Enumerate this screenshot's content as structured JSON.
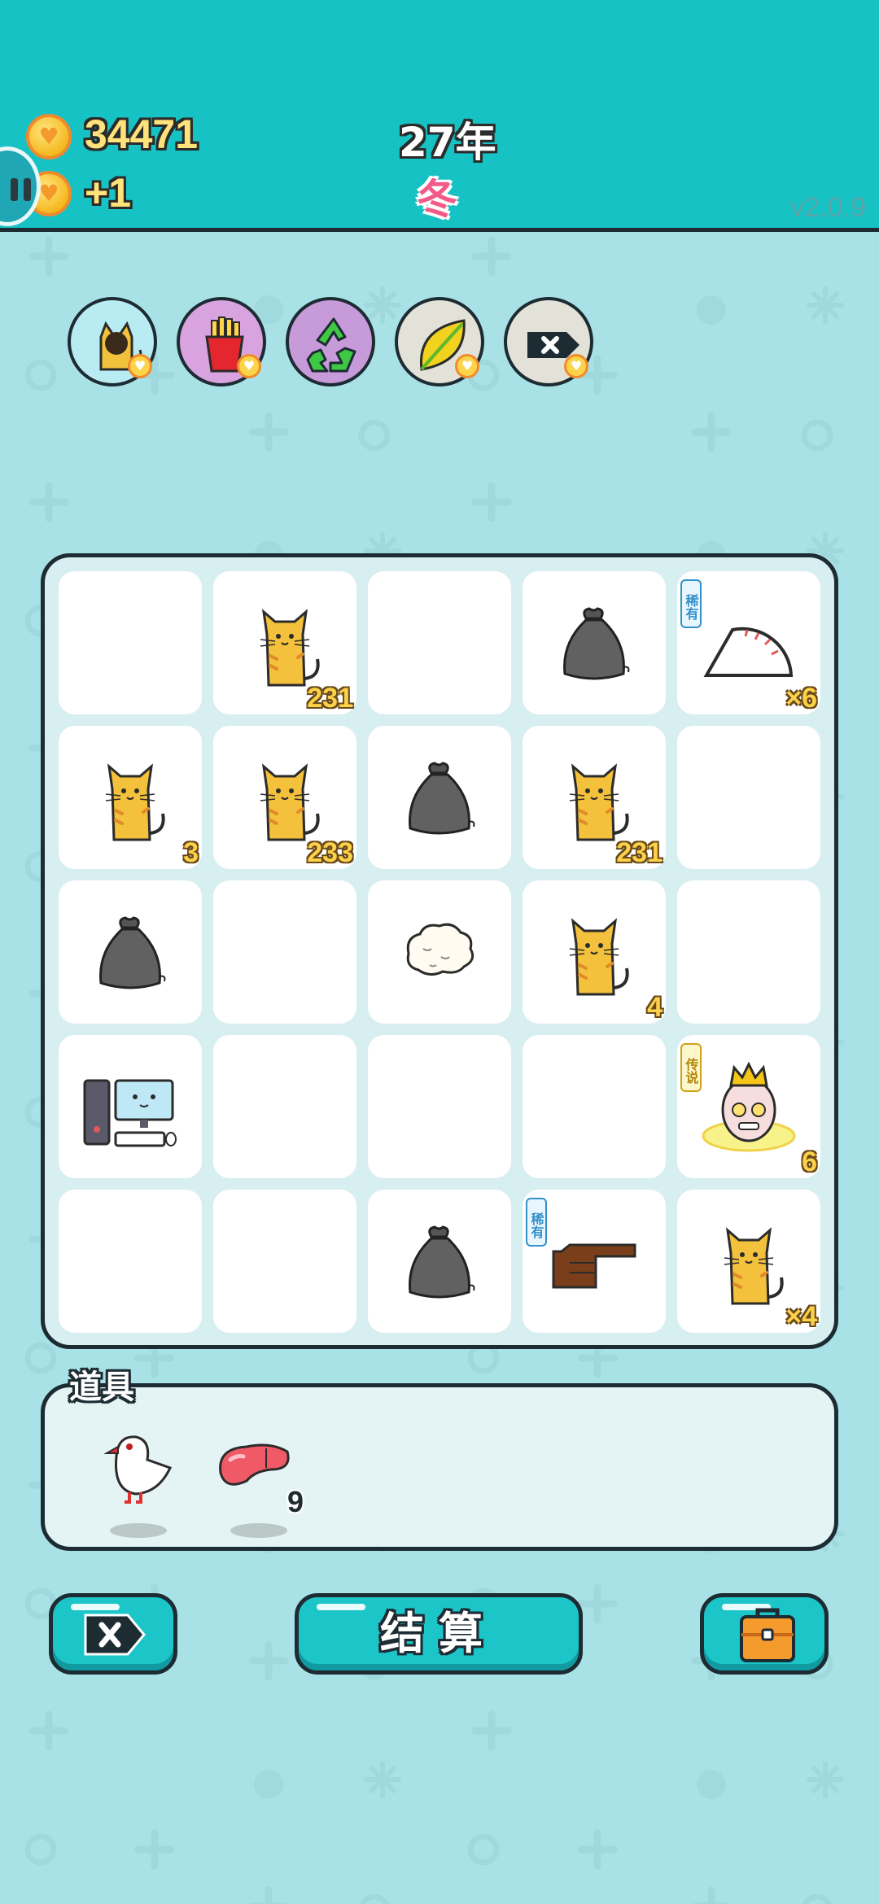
{
  "header": {
    "coins": "34471",
    "income": "+1",
    "year": "27年",
    "season": "冬",
    "version": "v2.0.9"
  },
  "skills": [
    "cat-skill-icon",
    "fries-skill-icon",
    "recycle-skill-icon",
    "leaf-skill-icon",
    "remove-skill-icon"
  ],
  "board": {
    "rows": 5,
    "cols": 5,
    "cells": [
      {
        "item": "",
        "count": ""
      },
      {
        "item": "cat",
        "count": "231"
      },
      {
        "item": "",
        "count": ""
      },
      {
        "item": "trash-bag",
        "count": ""
      },
      {
        "item": "gauge",
        "count": "×6",
        "tag": "稀有"
      },
      {
        "item": "cat",
        "count": "3"
      },
      {
        "item": "cat",
        "count": "233"
      },
      {
        "item": "trash-bag",
        "count": ""
      },
      {
        "item": "cat",
        "count": "231"
      },
      {
        "item": "",
        "count": ""
      },
      {
        "item": "trash-bag",
        "count": ""
      },
      {
        "item": "",
        "count": ""
      },
      {
        "item": "cotton",
        "count": ""
      },
      {
        "item": "cat",
        "count": "4"
      },
      {
        "item": "",
        "count": ""
      },
      {
        "item": "computer",
        "count": ""
      },
      {
        "item": "",
        "count": ""
      },
      {
        "item": "",
        "count": ""
      },
      {
        "item": "",
        "count": ""
      },
      {
        "item": "king",
        "count": "6",
        "tag": "传说"
      },
      {
        "item": "",
        "count": ""
      },
      {
        "item": "",
        "count": ""
      },
      {
        "item": "trash-bag",
        "count": ""
      },
      {
        "item": "pointing-hand",
        "count": "",
        "tag": "稀有"
      },
      {
        "item": "cat",
        "count": "×4"
      }
    ]
  },
  "props": {
    "title": "道具",
    "items": [
      {
        "icon": "bird-icon",
        "count": ""
      },
      {
        "icon": "liver-icon",
        "count": "9"
      }
    ]
  },
  "buttons": {
    "remove_icon": "remove-icon",
    "settle_label": "结算",
    "bag_icon": "briefcase-icon"
  },
  "colors": {
    "header_bg": "#17c2c4",
    "page_bg": "#a9e2e6",
    "board_bg": "#d7eff0",
    "button_bg": "#1cc5c8",
    "count_color": "#fcd24a",
    "season_color": "#f25a8a"
  }
}
